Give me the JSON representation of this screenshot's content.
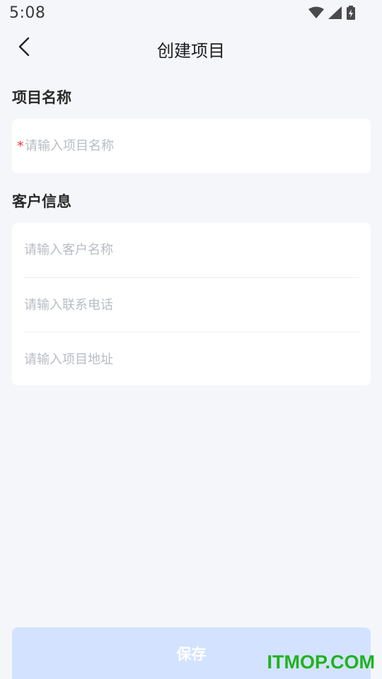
{
  "status_bar": {
    "time": "5:08",
    "icons": [
      "wifi-icon",
      "cell-signal-icon",
      "battery-charging-icon"
    ]
  },
  "header": {
    "title": "创建项目",
    "back_icon": "chevron-left-icon"
  },
  "project_section": {
    "title": "项目名称",
    "required_mark": "*",
    "name_placeholder": "请输入项目名称"
  },
  "customer_section": {
    "title": "客户信息",
    "customer_name_placeholder": "请输入客户名称",
    "phone_placeholder": "请输入联系电话",
    "address_placeholder": "请输入项目地址"
  },
  "footer": {
    "save_label": "保存"
  },
  "watermark": "ITMOP.COM",
  "colors": {
    "background": "#f5f6fa",
    "card": "#ffffff",
    "required": "#e53935",
    "save_button_disabled": "#d3e3ff",
    "watermark": "#20b21f"
  }
}
